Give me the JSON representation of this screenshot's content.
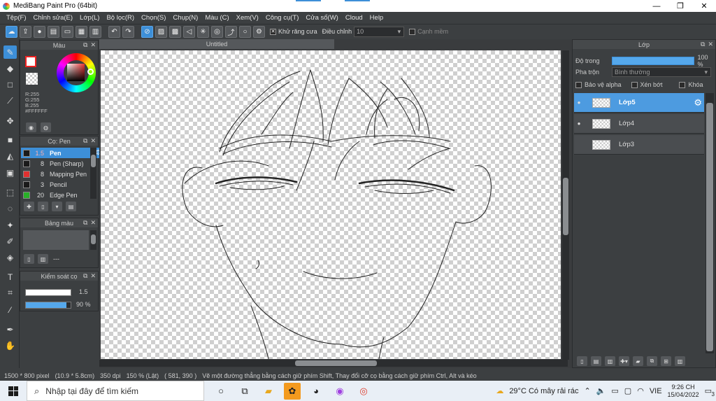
{
  "window": {
    "title": "MediBang Paint Pro (64bit)",
    "minimize": "—",
    "maximize": "❐",
    "close": "✕"
  },
  "menu": [
    "Tệp(F)",
    "Chỉnh sửa(E)",
    "Lớp(L)",
    "Bộ lọc(R)",
    "Chọn(S)",
    "Chụp(N)",
    "Màu (C)",
    "Xem(V)",
    "Công cụ(T)",
    "Cửa sổ(W)",
    "Cloud",
    "Help"
  ],
  "toolbar": {
    "antialias_label": "Khử răng cưa",
    "adjust_label": "Điều chỉnh",
    "adjust_value": "10",
    "edge_label": "Cạnh mềm"
  },
  "color_panel": {
    "title": "Màu",
    "r": "R:255",
    "g": "G:255",
    "b": "B:255",
    "hex": "#FFFFFF"
  },
  "brush_panel": {
    "title": "Cọ: Pen",
    "items": [
      {
        "size": "1.5",
        "name": "Pen",
        "color": "#1a1a1a"
      },
      {
        "size": "8",
        "name": "Pen (Sharp)",
        "color": "#1a1a1a"
      },
      {
        "size": "8",
        "name": "Mapping Pen",
        "color": "#e03030"
      },
      {
        "size": "3",
        "name": "Pencil",
        "color": "#1a1a1a"
      },
      {
        "size": "20",
        "name": "Edge Pen",
        "color": "#28b028"
      }
    ]
  },
  "palette_panel": {
    "title": "Bảng màu",
    "dash": "---"
  },
  "brush_control": {
    "title": "Kiểm soát cọ",
    "size_value": "1.5",
    "opacity_value": "90 %",
    "opacity_fraction": 0.9
  },
  "canvas": {
    "tab_title": "Untitled"
  },
  "layer_panel": {
    "title": "Lớp",
    "opacity_label": "Độ trong",
    "opacity_value": "100 %",
    "blend_label": "Pha trộn",
    "blend_value": "Bình thường",
    "protect_alpha": "Bảo vệ alpha",
    "clipping": "Xén bớt",
    "lock": "Khóa",
    "layers": [
      {
        "name": "Lớp5",
        "visible": true,
        "selected": true
      },
      {
        "name": "Lớp4",
        "visible": true,
        "selected": false
      },
      {
        "name": "Lớp3",
        "visible": false,
        "selected": false
      }
    ]
  },
  "statusbar": {
    "size": "1500 * 800 pixel",
    "physical": "(10.9 * 5.8cm)",
    "dpi": "350 dpi",
    "zoom": "150 % (Lật)",
    "coords": "( 581, 390 )",
    "hint": "Vẽ một đường thẳng bằng cách giữ phím Shift, Thay đổi cỡ cọ bằng cách giữ phím Ctrl, Alt và kéo"
  },
  "taskbar": {
    "search_placeholder": "Nhập tại đây để tìm kiếm",
    "weather": "29°C  Có mây rải rác",
    "lang": "VIE",
    "time": "9:26 CH",
    "date": "15/04/2022",
    "notif_count": "3"
  }
}
